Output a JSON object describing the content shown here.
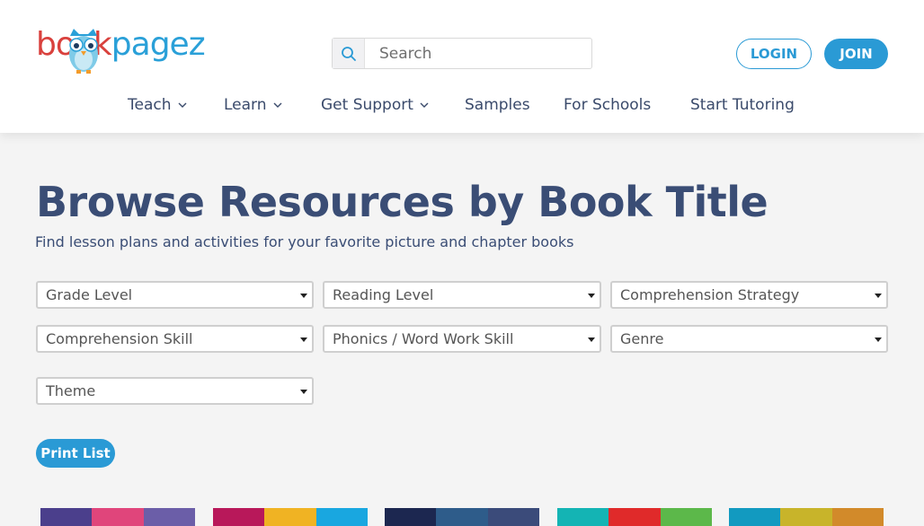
{
  "brand": {
    "logo_part1": "bo",
    "logo_part2": "k",
    "logo_part3": "pagez",
    "colors": {
      "red": "#d9413d",
      "blue": "#2aa0d8"
    }
  },
  "search": {
    "placeholder": "Search",
    "icon": "search-icon"
  },
  "auth": {
    "login_label": "LOGIN",
    "join_label": "JOIN"
  },
  "nav": {
    "items": [
      {
        "label": "Teach",
        "has_dropdown": true
      },
      {
        "label": "Learn",
        "has_dropdown": true
      },
      {
        "label": "Get Support",
        "has_dropdown": true
      },
      {
        "label": "Samples",
        "has_dropdown": false
      },
      {
        "label": "For Schools",
        "has_dropdown": false
      },
      {
        "label": "Start Tutoring",
        "has_dropdown": false
      }
    ]
  },
  "main": {
    "title": "Browse Resources by Book Title",
    "subtitle": "Find lesson plans and activities for your favorite picture and chapter books",
    "filters": [
      {
        "label": "Grade Level"
      },
      {
        "label": "Reading Level"
      },
      {
        "label": "Comprehension Strategy"
      },
      {
        "label": "Comprehension Skill"
      },
      {
        "label": "Phonics / Word Work Skill"
      },
      {
        "label": "Genre"
      },
      {
        "label": "Theme"
      }
    ],
    "print_label": "Print List"
  },
  "book_cards": [
    {
      "colors": [
        "#4b3f8c",
        "#e0457b",
        "#6b5ea8"
      ]
    },
    {
      "colors": [
        "#b8185a",
        "#f0b323",
        "#19a7e0"
      ]
    },
    {
      "colors": [
        "#1c2750",
        "#2e5c8a",
        "#3b4b7a"
      ]
    },
    {
      "colors": [
        "#14b4b4",
        "#e02a2a",
        "#5cb84a"
      ]
    },
    {
      "colors": [
        "#129ac0",
        "#c8b42a",
        "#d28a2a"
      ]
    }
  ]
}
